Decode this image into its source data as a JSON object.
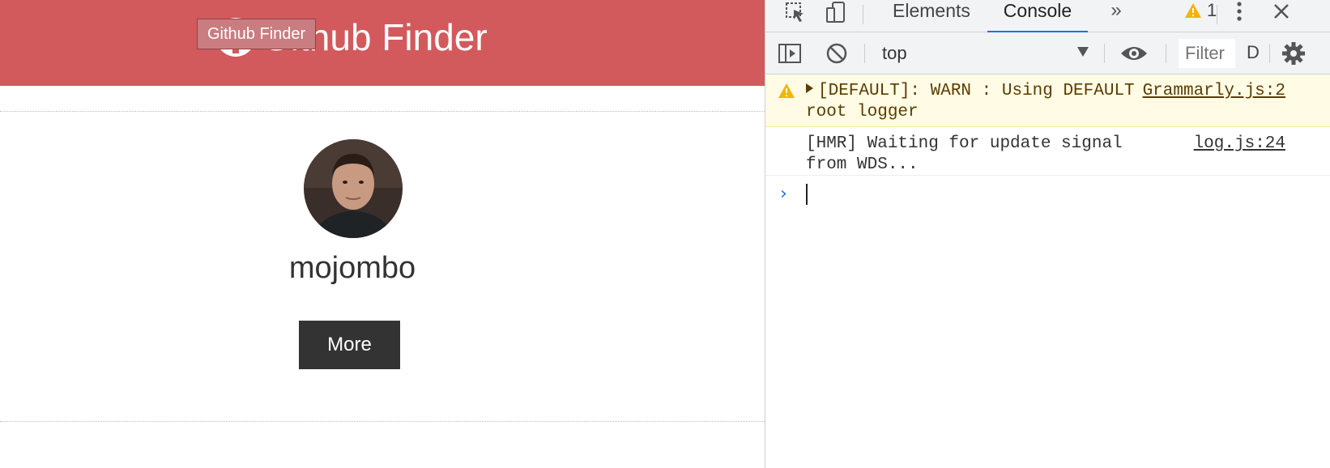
{
  "app": {
    "navbar": {
      "title": "Github Finder",
      "tooltip": "Github Finder",
      "background": "#d2595c"
    },
    "user": {
      "login": "mojombo",
      "more_label": "More"
    }
  },
  "devtools": {
    "tabs": [
      {
        "label": "Elements",
        "active": false
      },
      {
        "label": "Console",
        "active": true
      }
    ],
    "more_tabs_icon": "double-chevron-icon",
    "warning_count": "1",
    "context": "top",
    "filter_placeholder": "Filter",
    "levels_label": "D",
    "messages": [
      {
        "level": "warning",
        "text": "[DEFAULT]: WARN : Using DEFAULT root logger",
        "source": "Grammarly.js:2"
      },
      {
        "level": "log",
        "text": "[HMR] Waiting for update signal from WDS...",
        "source": "log.js:24"
      }
    ],
    "accent": "#1a73e8"
  }
}
